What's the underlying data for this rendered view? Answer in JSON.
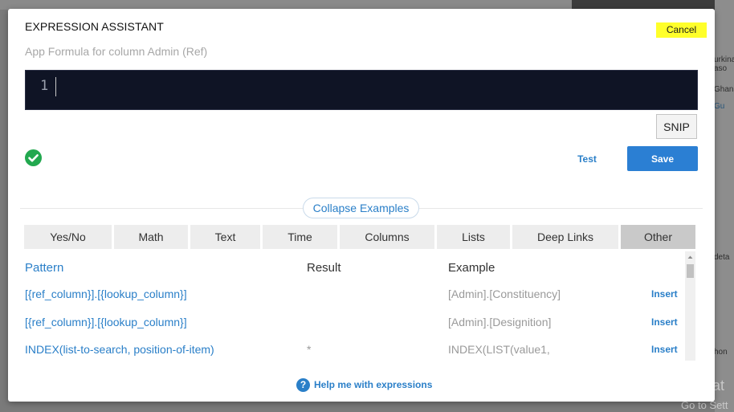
{
  "background": {
    "side_texts": [
      "urkina",
      "aso",
      "Ghana",
      "Gu",
      "deta",
      "hon"
    ],
    "activate_title": "Activat",
    "activate_sub": "Go to Sett"
  },
  "modal": {
    "title": "EXPRESSION ASSISTANT",
    "cancel_label": "Cancel",
    "subtitle": "App Formula for column Admin (Ref)",
    "editor": {
      "line_number": "1",
      "content": ""
    },
    "snip_label": "SNIP",
    "status_icon": "check-circle-icon",
    "test_label": "Test",
    "save_label": "Save",
    "collapse_label": "Collapse Examples",
    "tabs": [
      {
        "label": "Yes/No"
      },
      {
        "label": "Math"
      },
      {
        "label": "Text"
      },
      {
        "label": "Time"
      },
      {
        "label": "Columns"
      },
      {
        "label": "Lists"
      },
      {
        "label": "Deep Links"
      },
      {
        "label": "Other"
      }
    ],
    "active_tab": "Other",
    "table": {
      "headers": {
        "pattern": "Pattern",
        "result": "Result",
        "example": "Example"
      },
      "rows": [
        {
          "pattern": "[{ref_column}].[{lookup_column}]",
          "result": "",
          "example": "[Admin].[Constituency]",
          "insert": "Insert"
        },
        {
          "pattern": "[{ref_column}].[{lookup_column}]",
          "result": "",
          "example": "[Admin].[Designition]",
          "insert": "Insert"
        },
        {
          "pattern": "INDEX(list-to-search, position-of-item)",
          "result": "*",
          "example": "INDEX(LIST(value1,",
          "insert": "Insert"
        }
      ]
    },
    "help_label": "Help me with expressions"
  },
  "colors": {
    "accent": "#2a7fc8",
    "save": "#2b7fd3",
    "highlight": "#ffff2a",
    "success": "#22a84f",
    "editor_bg": "#0f1425"
  }
}
